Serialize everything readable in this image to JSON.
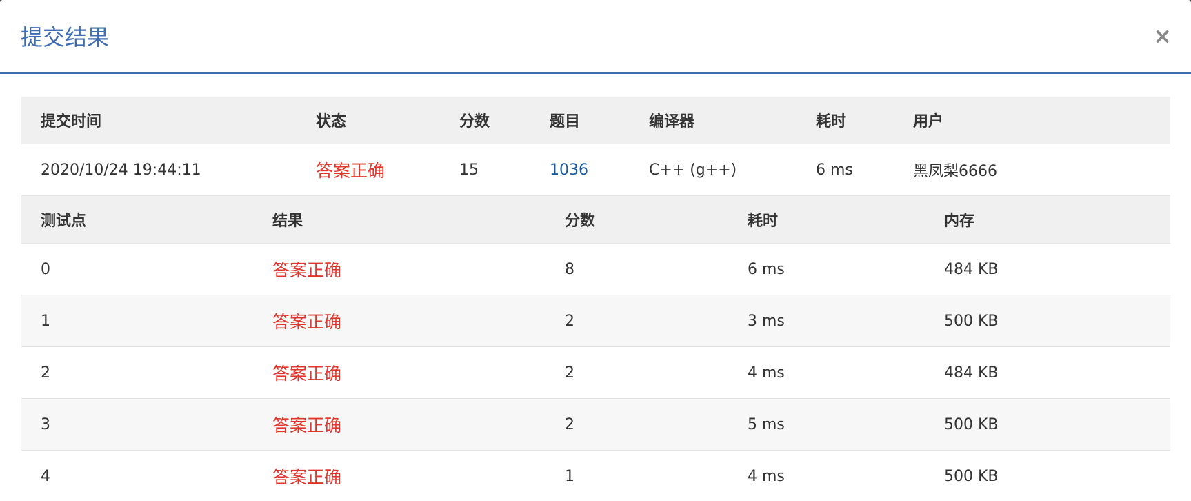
{
  "dialog": {
    "title": "提交结果",
    "close": "×"
  },
  "summary": {
    "headers": [
      "提交时间",
      "状态",
      "分数",
      "题目",
      "编译器",
      "耗时",
      "用户"
    ],
    "row": {
      "time": "2020/10/24 19:44:11",
      "status": "答案正确",
      "score": "15",
      "problem": "1036",
      "compiler": "C++ (g++)",
      "duration": "6 ms",
      "user": "黑凤梨6666"
    }
  },
  "tests": {
    "headers": [
      "测试点",
      "结果",
      "分数",
      "耗时",
      "内存"
    ],
    "rows": [
      {
        "id": "0",
        "result": "答案正确",
        "score": "8",
        "time": "6 ms",
        "memory": "484 KB"
      },
      {
        "id": "1",
        "result": "答案正确",
        "score": "2",
        "time": "3 ms",
        "memory": "500 KB"
      },
      {
        "id": "2",
        "result": "答案正确",
        "score": "2",
        "time": "4 ms",
        "memory": "484 KB"
      },
      {
        "id": "3",
        "result": "答案正确",
        "score": "2",
        "time": "5 ms",
        "memory": "500 KB"
      },
      {
        "id": "4",
        "result": "答案正确",
        "score": "1",
        "time": "4 ms",
        "memory": "500 KB"
      }
    ]
  },
  "colors": {
    "accent": "#3f6db3",
    "success": "#e0372d",
    "link": "#1a5a9e"
  }
}
